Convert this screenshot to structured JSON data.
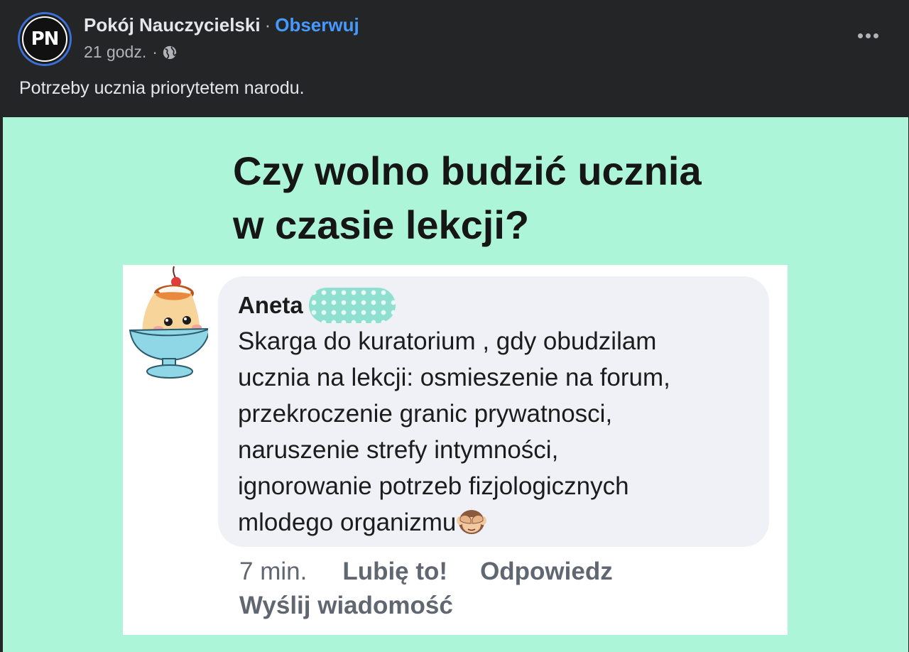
{
  "post": {
    "page_name": "Pokój Nauczycielski",
    "separator": "·",
    "follow_label": "Obserwuj",
    "time_ago": "21 godz.",
    "meta_separator": "·",
    "privacy_icon": "globe-icon",
    "more_icon": "more-horizontal-icon",
    "avatar_text": "PN",
    "text": "Potrzeby ucznia priorytetem narodu."
  },
  "image": {
    "background_color": "#adf5d8",
    "title_lines": [
      "Czy wolno budzić ucznia",
      "w czasie lekcji?"
    ],
    "comment": {
      "author": "Aneta",
      "avatar_icon": "pudding-cup-icon",
      "body_lines": [
        "Skarga do kuratorium , gdy obudzilam",
        "ucznia na lekcji: osmieszenie na forum,",
        "przekroczenie granic prywatnosci,",
        "naruszenie strefy intymności,",
        "ignorowanie potrzeb fizjologicznych",
        "mlodego organizmu"
      ],
      "emoji": "see-no-evil-monkey-icon",
      "time": "7 min.",
      "like_label": "Lubię to!",
      "reply_label": "Odpowiedz",
      "message_label": "Wyślij wiadomość"
    }
  }
}
